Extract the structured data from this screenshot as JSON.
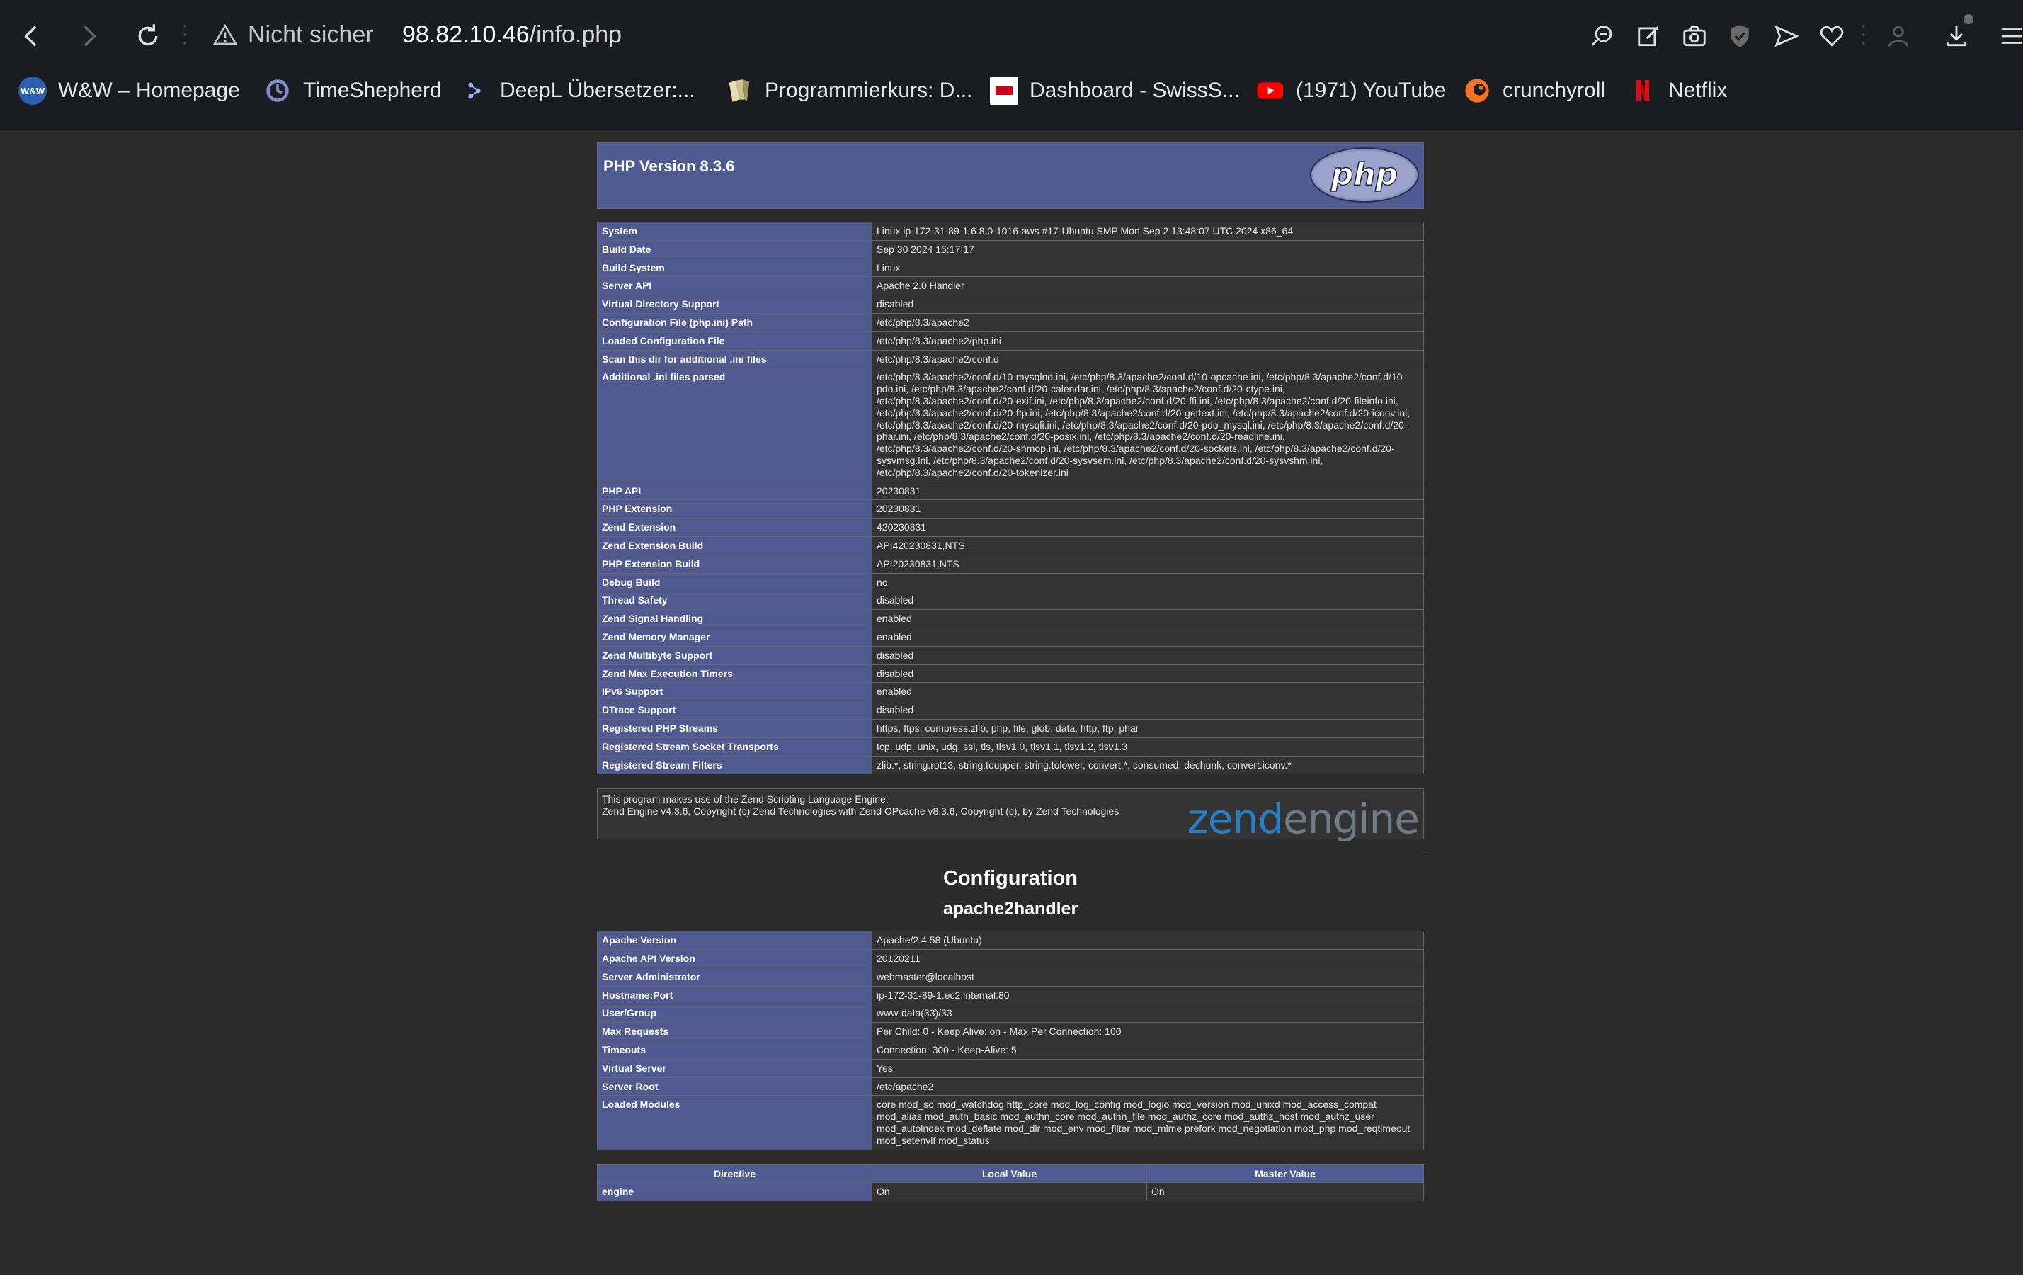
{
  "browser": {
    "security_label": "Nicht sicher",
    "url_host": "98.82.10.46",
    "url_path": "/info.php",
    "bookmarks": [
      {
        "label": "W&W – Homepage",
        "icon": "ww-icon",
        "color": "#2b5fb0"
      },
      {
        "label": "TimeShepherd",
        "icon": "timeshepherd-icon",
        "color": "#5a6aa8"
      },
      {
        "label": "DeepL Übersetzer:...",
        "icon": "deepl-icon",
        "color": "#0f2b46"
      },
      {
        "label": "Programmierkurs: D...",
        "icon": "book-icon",
        "color": "#e3d3a3"
      },
      {
        "label": "Dashboard - SwissS...",
        "icon": "dashboard-icon",
        "color": "#ffffff"
      },
      {
        "label": "(1971) YouTube",
        "icon": "youtube-icon",
        "color": "#ff0000"
      },
      {
        "label": "crunchyroll",
        "icon": "crunchyroll-icon",
        "color": "#f47521"
      },
      {
        "label": "Netflix",
        "icon": "netflix-icon",
        "color": "#e50914"
      }
    ]
  },
  "header": {
    "title": "PHP Version 8.3.6",
    "logo_text": "php"
  },
  "general": [
    [
      "System",
      "Linux ip-172-31-89-1 6.8.0-1016-aws #17-Ubuntu SMP Mon Sep 2 13:48:07 UTC 2024 x86_64"
    ],
    [
      "Build Date",
      "Sep 30 2024 15:17:17"
    ],
    [
      "Build System",
      "Linux"
    ],
    [
      "Server API",
      "Apache 2.0 Handler"
    ],
    [
      "Virtual Directory Support",
      "disabled"
    ],
    [
      "Configuration File (php.ini) Path",
      "/etc/php/8.3/apache2"
    ],
    [
      "Loaded Configuration File",
      "/etc/php/8.3/apache2/php.ini"
    ],
    [
      "Scan this dir for additional .ini files",
      "/etc/php/8.3/apache2/conf.d"
    ],
    [
      "Additional .ini files parsed",
      "/etc/php/8.3/apache2/conf.d/10-mysqlnd.ini, /etc/php/8.3/apache2/conf.d/10-opcache.ini, /etc/php/8.3/apache2/conf.d/10-pdo.ini, /etc/php/8.3/apache2/conf.d/20-calendar.ini, /etc/php/8.3/apache2/conf.d/20-ctype.ini, /etc/php/8.3/apache2/conf.d/20-exif.ini, /etc/php/8.3/apache2/conf.d/20-ffi.ini, /etc/php/8.3/apache2/conf.d/20-fileinfo.ini, /etc/php/8.3/apache2/conf.d/20-ftp.ini, /etc/php/8.3/apache2/conf.d/20-gettext.ini, /etc/php/8.3/apache2/conf.d/20-iconv.ini, /etc/php/8.3/apache2/conf.d/20-mysqli.ini, /etc/php/8.3/apache2/conf.d/20-pdo_mysql.ini, /etc/php/8.3/apache2/conf.d/20-phar.ini, /etc/php/8.3/apache2/conf.d/20-posix.ini, /etc/php/8.3/apache2/conf.d/20-readline.ini, /etc/php/8.3/apache2/conf.d/20-shmop.ini, /etc/php/8.3/apache2/conf.d/20-sockets.ini, /etc/php/8.3/apache2/conf.d/20-sysvmsg.ini, /etc/php/8.3/apache2/conf.d/20-sysvsem.ini, /etc/php/8.3/apache2/conf.d/20-sysvshm.ini, /etc/php/8.3/apache2/conf.d/20-tokenizer.ini"
    ],
    [
      "PHP API",
      "20230831"
    ],
    [
      "PHP Extension",
      "20230831"
    ],
    [
      "Zend Extension",
      "420230831"
    ],
    [
      "Zend Extension Build",
      "API420230831,NTS"
    ],
    [
      "PHP Extension Build",
      "API20230831,NTS"
    ],
    [
      "Debug Build",
      "no"
    ],
    [
      "Thread Safety",
      "disabled"
    ],
    [
      "Zend Signal Handling",
      "enabled"
    ],
    [
      "Zend Memory Manager",
      "enabled"
    ],
    [
      "Zend Multibyte Support",
      "disabled"
    ],
    [
      "Zend Max Execution Timers",
      "disabled"
    ],
    [
      "IPv6 Support",
      "enabled"
    ],
    [
      "DTrace Support",
      "disabled"
    ],
    [
      "Registered PHP Streams",
      "https, ftps, compress.zlib, php, file, glob, data, http, ftp, phar"
    ],
    [
      "Registered Stream Socket Transports",
      "tcp, udp, unix, udg, ssl, tls, tlsv1.0, tlsv1.1, tlsv1.2, tlsv1.3"
    ],
    [
      "Registered Stream Filters",
      "zlib.*, string.rot13, string.toupper, string.tolower, convert.*, consumed, dechunk, convert.iconv.*"
    ]
  ],
  "zend": {
    "line1": "This program makes use of the Zend Scripting Language Engine:",
    "line2": "Zend Engine v4.3.6, Copyright (c) Zend Technologies with Zend OPcache v8.3.6, Copyright (c), by Zend Technologies",
    "logo_a": "zend",
    "logo_b": "engine"
  },
  "configuration": {
    "title": "Configuration",
    "module": "apache2handler",
    "rows": [
      [
        "Apache Version",
        "Apache/2.4.58 (Ubuntu)"
      ],
      [
        "Apache API Version",
        "20120211"
      ],
      [
        "Server Administrator",
        "webmaster@localhost"
      ],
      [
        "Hostname:Port",
        "ip-172-31-89-1.ec2.internal:80"
      ],
      [
        "User/Group",
        "www-data(33)/33"
      ],
      [
        "Max Requests",
        "Per Child: 0 - Keep Alive: on - Max Per Connection: 100"
      ],
      [
        "Timeouts",
        "Connection: 300 - Keep-Alive: 5"
      ],
      [
        "Virtual Server",
        "Yes"
      ],
      [
        "Server Root",
        "/etc/apache2"
      ],
      [
        "Loaded Modules",
        "core mod_so mod_watchdog http_core mod_log_config mod_logio mod_version mod_unixd mod_access_compat mod_alias mod_auth_basic mod_authn_core mod_authn_file mod_authz_core mod_authz_host mod_authz_user mod_autoindex mod_deflate mod_dir mod_env mod_filter mod_mime prefork mod_negotiation mod_php mod_reqtimeout mod_setenvif mod_status"
      ]
    ],
    "directive_headers": [
      "Directive",
      "Local Value",
      "Master Value"
    ],
    "directive_rows": [
      [
        "engine",
        "On",
        "On"
      ]
    ]
  },
  "colors": {
    "header_bg": "#4f5b93",
    "cell_bg": "#333333",
    "page_bg": "#2b2b2b"
  }
}
